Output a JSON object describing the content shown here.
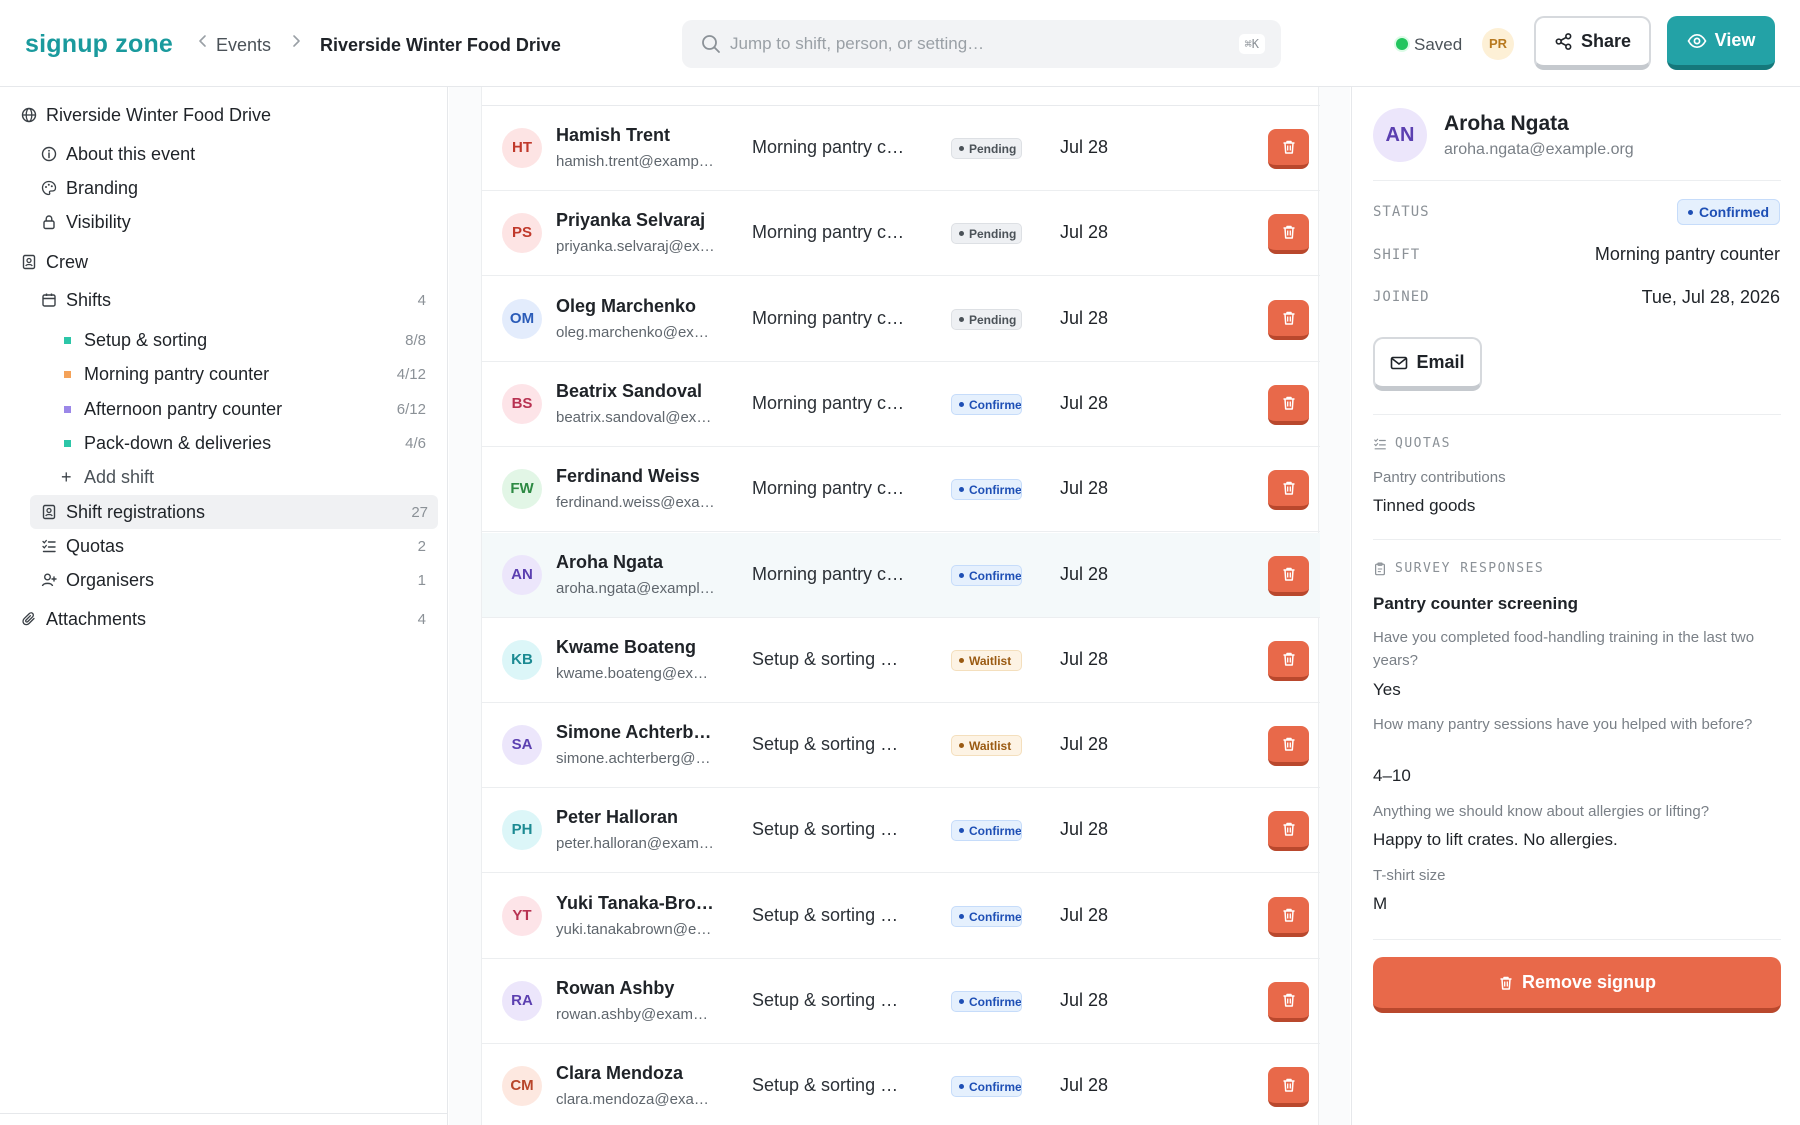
{
  "header": {
    "brand": "signup zone",
    "breadcrumb_events": "Events",
    "breadcrumb_title": "Riverside Winter Food Drive",
    "search_placeholder": "Jump to shift, person, or setting…",
    "search_shortcut": "⌘K",
    "saved_label": "Saved",
    "user_initials": "PR",
    "share_label": "Share",
    "view_label": "View",
    "colors": {
      "brand": "#1a9a9d",
      "primary": "#23a2a6",
      "danger": "#e8694a",
      "success": "#22c55e"
    }
  },
  "sidebar": {
    "event": "Riverside Winter Food Drive",
    "about": "About this event",
    "branding": "Branding",
    "visibility": "Visibility",
    "crew": "Crew",
    "shifts": {
      "label": "Shifts",
      "count": "4"
    },
    "shift_items": [
      {
        "label": "Setup & sorting",
        "count": "8/8",
        "color": "#2cc6a8"
      },
      {
        "label": "Morning pantry counter",
        "count": "4/12",
        "color": "#f4a259"
      },
      {
        "label": "Afternoon pantry counter",
        "count": "6/12",
        "color": "#9b87e8"
      },
      {
        "label": "Pack-down & deliveries",
        "count": "4/6",
        "color": "#2cc6a8"
      }
    ],
    "add_shift": "Add shift",
    "registrations": {
      "label": "Shift registrations",
      "count": "27"
    },
    "quotas": {
      "label": "Quotas",
      "count": "2"
    },
    "organisers": {
      "label": "Organisers",
      "count": "1"
    },
    "attachments": {
      "label": "Attachments",
      "count": "4"
    }
  },
  "registrations": [
    {
      "initials": "HT",
      "name": "Hamish Trent",
      "email": "hamish.trent@example.org",
      "shift": "Morning pantry counter",
      "shift_extra": "",
      "status": "Pending",
      "status_key": "pending",
      "date": "Jul 28",
      "av_bg": "#fde4e4",
      "av_fg": "#c0392b"
    },
    {
      "initials": "PS",
      "name": "Priyanka Selvaraj",
      "email": "priyanka.selvaraj@example.org",
      "shift": "Morning pantry counter",
      "shift_extra": "",
      "status": "Pending",
      "status_key": "pending",
      "date": "Jul 28",
      "av_bg": "#fde4e4",
      "av_fg": "#c0392b"
    },
    {
      "initials": "OM",
      "name": "Oleg Marchenko",
      "email": "oleg.marchenko@example.org",
      "shift": "Morning pantry counter",
      "shift_extra": "",
      "status": "Pending",
      "status_key": "pending",
      "date": "Jul 28",
      "av_bg": "#e3ecfc",
      "av_fg": "#2a5bb8"
    },
    {
      "initials": "BS",
      "name": "Beatrix Sandoval",
      "email": "beatrix.sandoval@example.org",
      "shift": "Morning pantry counter",
      "shift_extra": "",
      "status": "Confirmed",
      "status_key": "confirmed",
      "date": "Jul 28",
      "av_bg": "#fde4e8",
      "av_fg": "#b83252"
    },
    {
      "initials": "FW",
      "name": "Ferdinand Weiss",
      "email": "ferdinand.weiss@example.org",
      "shift": "Morning pantry counter",
      "shift_extra": "",
      "status": "Confirmed",
      "status_key": "confirmed",
      "date": "Jul 28",
      "av_bg": "#e2f6e6",
      "av_fg": "#2d8a43"
    },
    {
      "initials": "AN",
      "name": "Aroha Ngata",
      "email": "aroha.ngata@example.org",
      "shift": "Morning pantry counter",
      "shift_extra": "",
      "status": "Confirmed",
      "status_key": "confirmed",
      "date": "Jul 28",
      "av_bg": "#ece6fb",
      "av_fg": "#5b3fb0",
      "selected": true
    },
    {
      "initials": "KB",
      "name": "Kwame Boateng",
      "email": "kwame.boateng@example.org",
      "shift": "Setup & sorting",
      "shift_extra": "A…",
      "status": "Waitlist",
      "status_key": "waitlist",
      "date": "Jul 28",
      "av_bg": "#dcf6f8",
      "av_fg": "#1c8a92"
    },
    {
      "initials": "SA",
      "name": "Simone Achterberg",
      "email": "simone.achterberg@example.org",
      "shift": "Setup & sorting",
      "shift_extra": "A…",
      "status": "Waitlist",
      "status_key": "waitlist",
      "date": "Jul 28",
      "av_bg": "#ece6fb",
      "av_fg": "#5b3fb0"
    },
    {
      "initials": "PH",
      "name": "Peter Halloran",
      "email": "peter.halloran@example.org",
      "shift": "Setup & sorting",
      "shift_extra": "A…",
      "status": "Confirmed",
      "status_key": "confirmed",
      "date": "Jul 28",
      "av_bg": "#dcf6f8",
      "av_fg": "#1c8a92"
    },
    {
      "initials": "YT",
      "name": "Yuki Tanaka-Brown",
      "email": "yuki.tanakabrown@example.org",
      "shift": "Setup & sorting",
      "shift_extra": "A…",
      "status": "Confirmed",
      "status_key": "confirmed",
      "date": "Jul 28",
      "av_bg": "#fde4e8",
      "av_fg": "#b83252"
    },
    {
      "initials": "RA",
      "name": "Rowan Ashby",
      "email": "rowan.ashby@example.org",
      "shift": "Setup & sorting",
      "shift_extra": "A…",
      "status": "Confirmed",
      "status_key": "confirmed",
      "date": "Jul 28",
      "av_bg": "#ece6fb",
      "av_fg": "#5b3fb0"
    },
    {
      "initials": "CM",
      "name": "Clara Mendoza",
      "email": "clara.mendoza@example.org",
      "shift": "Setup & sorting",
      "shift_extra": "A…",
      "status": "Confirmed",
      "status_key": "confirmed",
      "date": "Jul 28",
      "av_bg": "#fde8e0",
      "av_fg": "#b8452a"
    }
  ],
  "detail": {
    "initials": "AN",
    "name": "Aroha Ngata",
    "email": "aroha.ngata@example.org",
    "status_label": "STATUS",
    "status_value": "Confirmed",
    "shift_label": "SHIFT",
    "shift_value": "Morning pantry counter",
    "joined_label": "JOINED",
    "joined_value": "Tue, Jul 28, 2026",
    "email_button": "Email",
    "quotas_heading": "QUOTAS",
    "quota_label": "Pantry contributions",
    "quota_value": "Tinned goods",
    "survey_heading": "SURVEY RESPONSES",
    "survey_title": "Pantry counter screening",
    "q1": "Have you completed food-handling training in the last two years?",
    "a1": "Yes",
    "q2": "How many pantry sessions have you helped with before?",
    "a2": "4–10",
    "q3": "Anything we should know about allergies or lifting?",
    "a3": "Happy to lift crates. No allergies.",
    "q4": "T-shirt size",
    "a4": "M",
    "remove_button": "Remove signup"
  }
}
